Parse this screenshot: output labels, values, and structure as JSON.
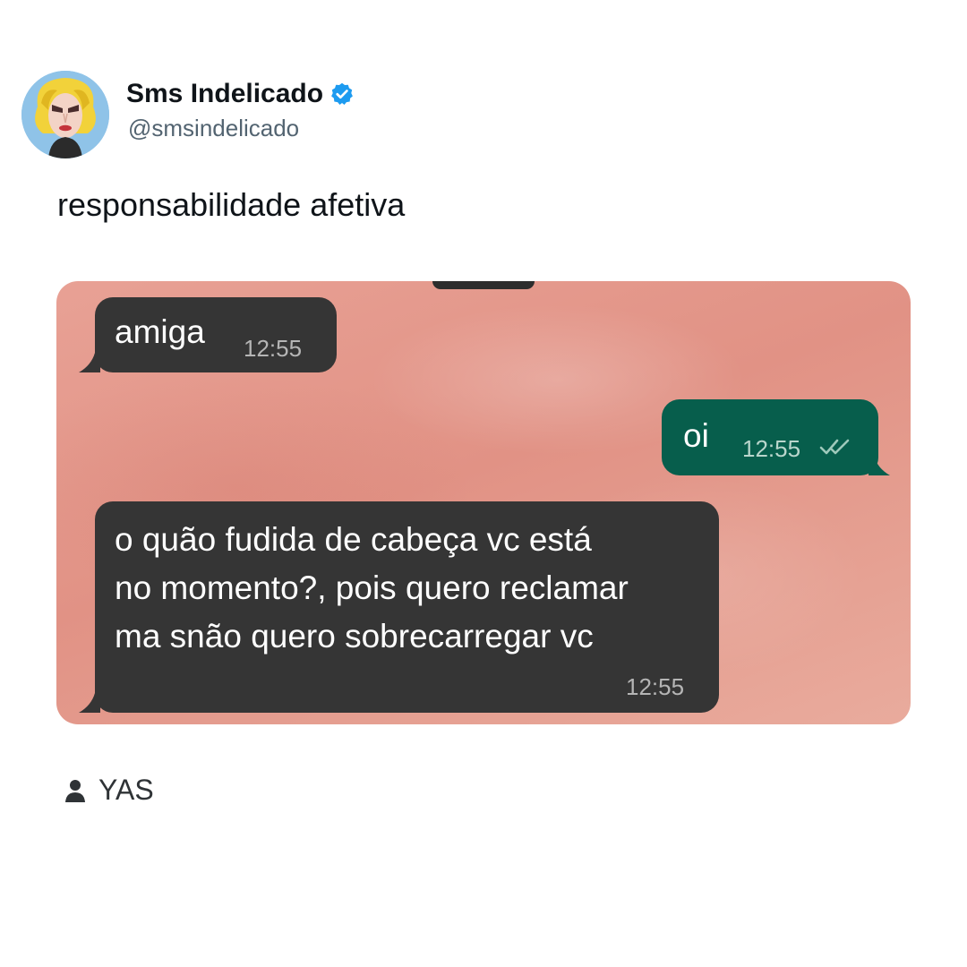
{
  "post": {
    "display_name": "Sms Indelicado",
    "handle": "@smsindelicado",
    "text": "responsabilidade afetiva",
    "verified": true,
    "verified_color": "#1d9bf0"
  },
  "chat": {
    "messages": [
      {
        "direction": "incoming",
        "lines": [
          "amiga"
        ],
        "time": "12:55"
      },
      {
        "direction": "outgoing",
        "lines": [
          "oi"
        ],
        "time": "12:55",
        "status": "read-double-check"
      },
      {
        "direction": "incoming",
        "lines": [
          "o quão fudida de cabeça vc está",
          "no momento?, pois quero reclamar",
          "ma snão quero sobrecarregar vc"
        ],
        "time": "12:55"
      }
    ],
    "incoming_bubble_color": "#353535",
    "outgoing_bubble_color": "#075e4c"
  },
  "credit": {
    "icon": "person-icon",
    "label": "YAS"
  }
}
